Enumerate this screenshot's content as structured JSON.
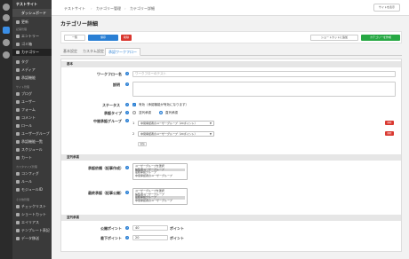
{
  "sidebar": {
    "site_name": "テストサイト",
    "dashboard": "ダッシュボード",
    "items_top": [
      {
        "label": "更新"
      }
    ],
    "section_content": "記事管理",
    "items_content": [
      {
        "label": "エントリー"
      },
      {
        "label": "ゴミ箱"
      },
      {
        "label": "カテゴリー"
      },
      {
        "label": "タグ"
      },
      {
        "label": "メディア"
      },
      {
        "label": "承認機能"
      }
    ],
    "section_site": "サイト管理",
    "items_site": [
      {
        "label": "ブログ"
      },
      {
        "label": "ユーザー"
      },
      {
        "label": "フォーム"
      },
      {
        "label": "コメント"
      },
      {
        "label": "ロール"
      },
      {
        "label": "ユーザーグループ"
      },
      {
        "label": "承認機能一覧"
      },
      {
        "label": "スケジュール"
      },
      {
        "label": "カート"
      }
    ],
    "section_custom": "カスタマイズ管理",
    "items_custom": [
      {
        "label": "コンフィグ"
      },
      {
        "label": "ルール"
      },
      {
        "label": "モジュールID"
      }
    ],
    "section_other": "その他管理",
    "items_other": [
      {
        "label": "チェックリスト"
      },
      {
        "label": "ショートカット"
      },
      {
        "label": "エイリアス"
      },
      {
        "label": "テンプレート表記"
      },
      {
        "label": "データ移送"
      }
    ]
  },
  "topbar": {
    "breadcrumbs": [
      "テストサイト",
      "カテゴリー管理",
      "カテゴリー詳細"
    ],
    "site_button": "サイトを表示"
  },
  "page": {
    "title": "カテゴリー詳細"
  },
  "actions": {
    "list": "一覧",
    "save": "保存",
    "delete": "削除",
    "shortcut": "ショートカットに追加",
    "tree": "カテゴリーを作成"
  },
  "tabs": [
    "基本設定",
    "カスタム設定",
    "承認ワークフロー"
  ],
  "form": {
    "section_basic": "基本",
    "workflow_label": "ワークフロー名",
    "workflow_placeholder": "ワークフローのテスト",
    "description_label": "説明",
    "status_label": "ステータス",
    "status_text": "有効（承認機能が有効になります）",
    "approval_type_label": "承認タイプ",
    "approval_type_options": [
      "並列承認",
      "直列承認"
    ],
    "group_label": "中間承認グループ",
    "group_rows": [
      {
        "num": "1",
        "value": "中間承認者のユーザーグループ（20ポイント）"
      },
      {
        "num": "2",
        "value": "中間承認者のユーザーグループ（20ポイント）"
      }
    ],
    "row_delete": "削除",
    "row_add": "追加",
    "section_approval": "並列承認",
    "start_label": "承認依頼（記事作成）",
    "start_options": [
      "ユーザーグループを選択",
      "編集者ユーザーグループ",
      "最終承認グループ",
      "中間承認者のユーザーグループ"
    ],
    "final_label": "最終承認（記事公開）",
    "final_options": [
      "ユーザーグループを選択",
      "編集者ユーザーグループ",
      "最終承認グループ",
      "中間承認者のユーザーグループ"
    ],
    "section_points": "並列承認",
    "pass_label": "公開ポイント",
    "pass_value": "40",
    "reject_label": "差下ポイント",
    "reject_value": "20",
    "unit": "ポイント"
  },
  "colors": {
    "accent": "#2a7fd4",
    "danger": "#d9372f",
    "success": "#27a844",
    "sidebar_bg": "#3a3a3a"
  }
}
